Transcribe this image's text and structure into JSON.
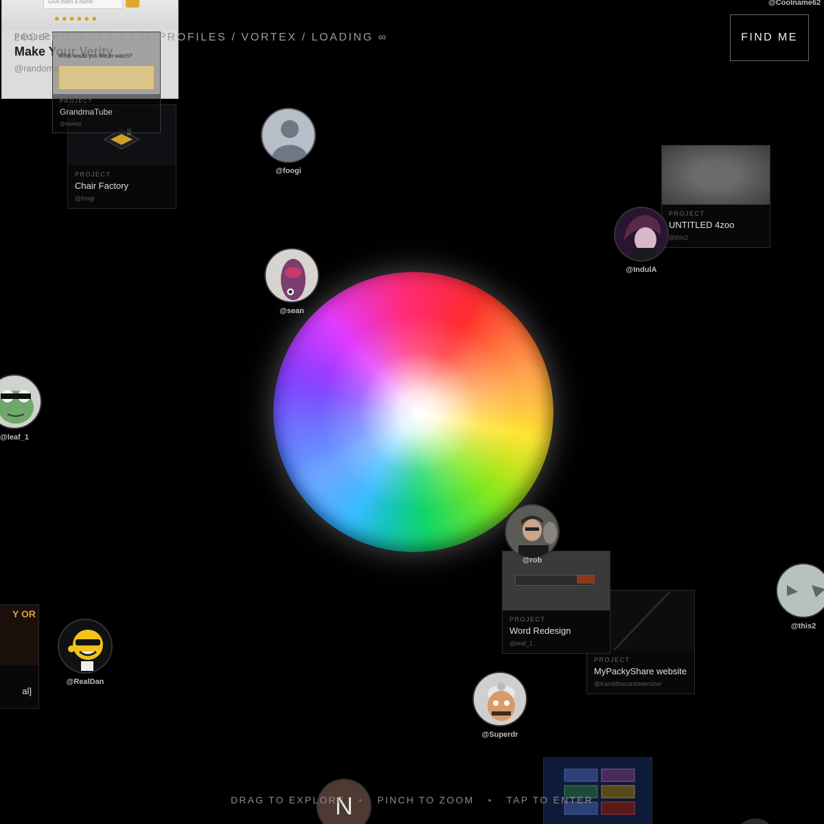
{
  "header": {
    "stats": "200 PROJECTS / 134 PROFILES / VORTEX / LOADING ∞",
    "find_me_label": "FIND ME",
    "corner_handle": "@Coolname62"
  },
  "footer": {
    "hint_drag": "DRAG TO EXPLORE",
    "hint_pinch": "PINCH TO ZOOM",
    "hint_tap": "TAP TO ENTER",
    "separator": "•"
  },
  "vortex": {
    "colors": [
      "#ff2b2b",
      "#ffe21a",
      "#10d66a",
      "#19b3ff",
      "#7a3cff",
      "#ff2b7a"
    ]
  },
  "profiles": {
    "foogi": {
      "handle": "@foogi"
    },
    "sean": {
      "handle": "@sean"
    },
    "indula": {
      "handle": "@IndulA"
    },
    "leaf_1": {
      "handle": "@leaf_1"
    },
    "rob": {
      "handle": "@rob"
    },
    "this2": {
      "handle": "@this2"
    },
    "realdan": {
      "handle": "@RealDan"
    },
    "superdr": {
      "handle": "@Superdr"
    },
    "n_avatar": {
      "letter": "N"
    }
  },
  "projects": {
    "make_your_verity": {
      "kicker": "PROJECT",
      "title": "Make Your Verity",
      "owner": "@randompeopletolovewebsim",
      "thumb_text": "Give them a name"
    },
    "grandmatube": {
      "kicker": "PROJECT",
      "title": "GrandmaTube",
      "owner": "@sweep",
      "thumb_text": "What would you like to watch?"
    },
    "chair_factory": {
      "kicker": "PROJECT",
      "title": "Chair Factory",
      "owner": "@foogi"
    },
    "untitled_4zoo": {
      "kicker": "PROJECT",
      "title": "UNTITLED 4zoo",
      "owner": "@this2"
    },
    "word_redesign": {
      "kicker": "PROJECT",
      "title": "Word Redesign",
      "owner": "@leaf_1"
    },
    "mypackyshare": {
      "kicker": "PROJECT",
      "title": "MyPackyShare website",
      "owner": "@Kamilthecontretemizer"
    },
    "left_partial": {
      "title_fragment": "al]",
      "thumb_text": "Y OR"
    },
    "bottom_partial": {}
  }
}
